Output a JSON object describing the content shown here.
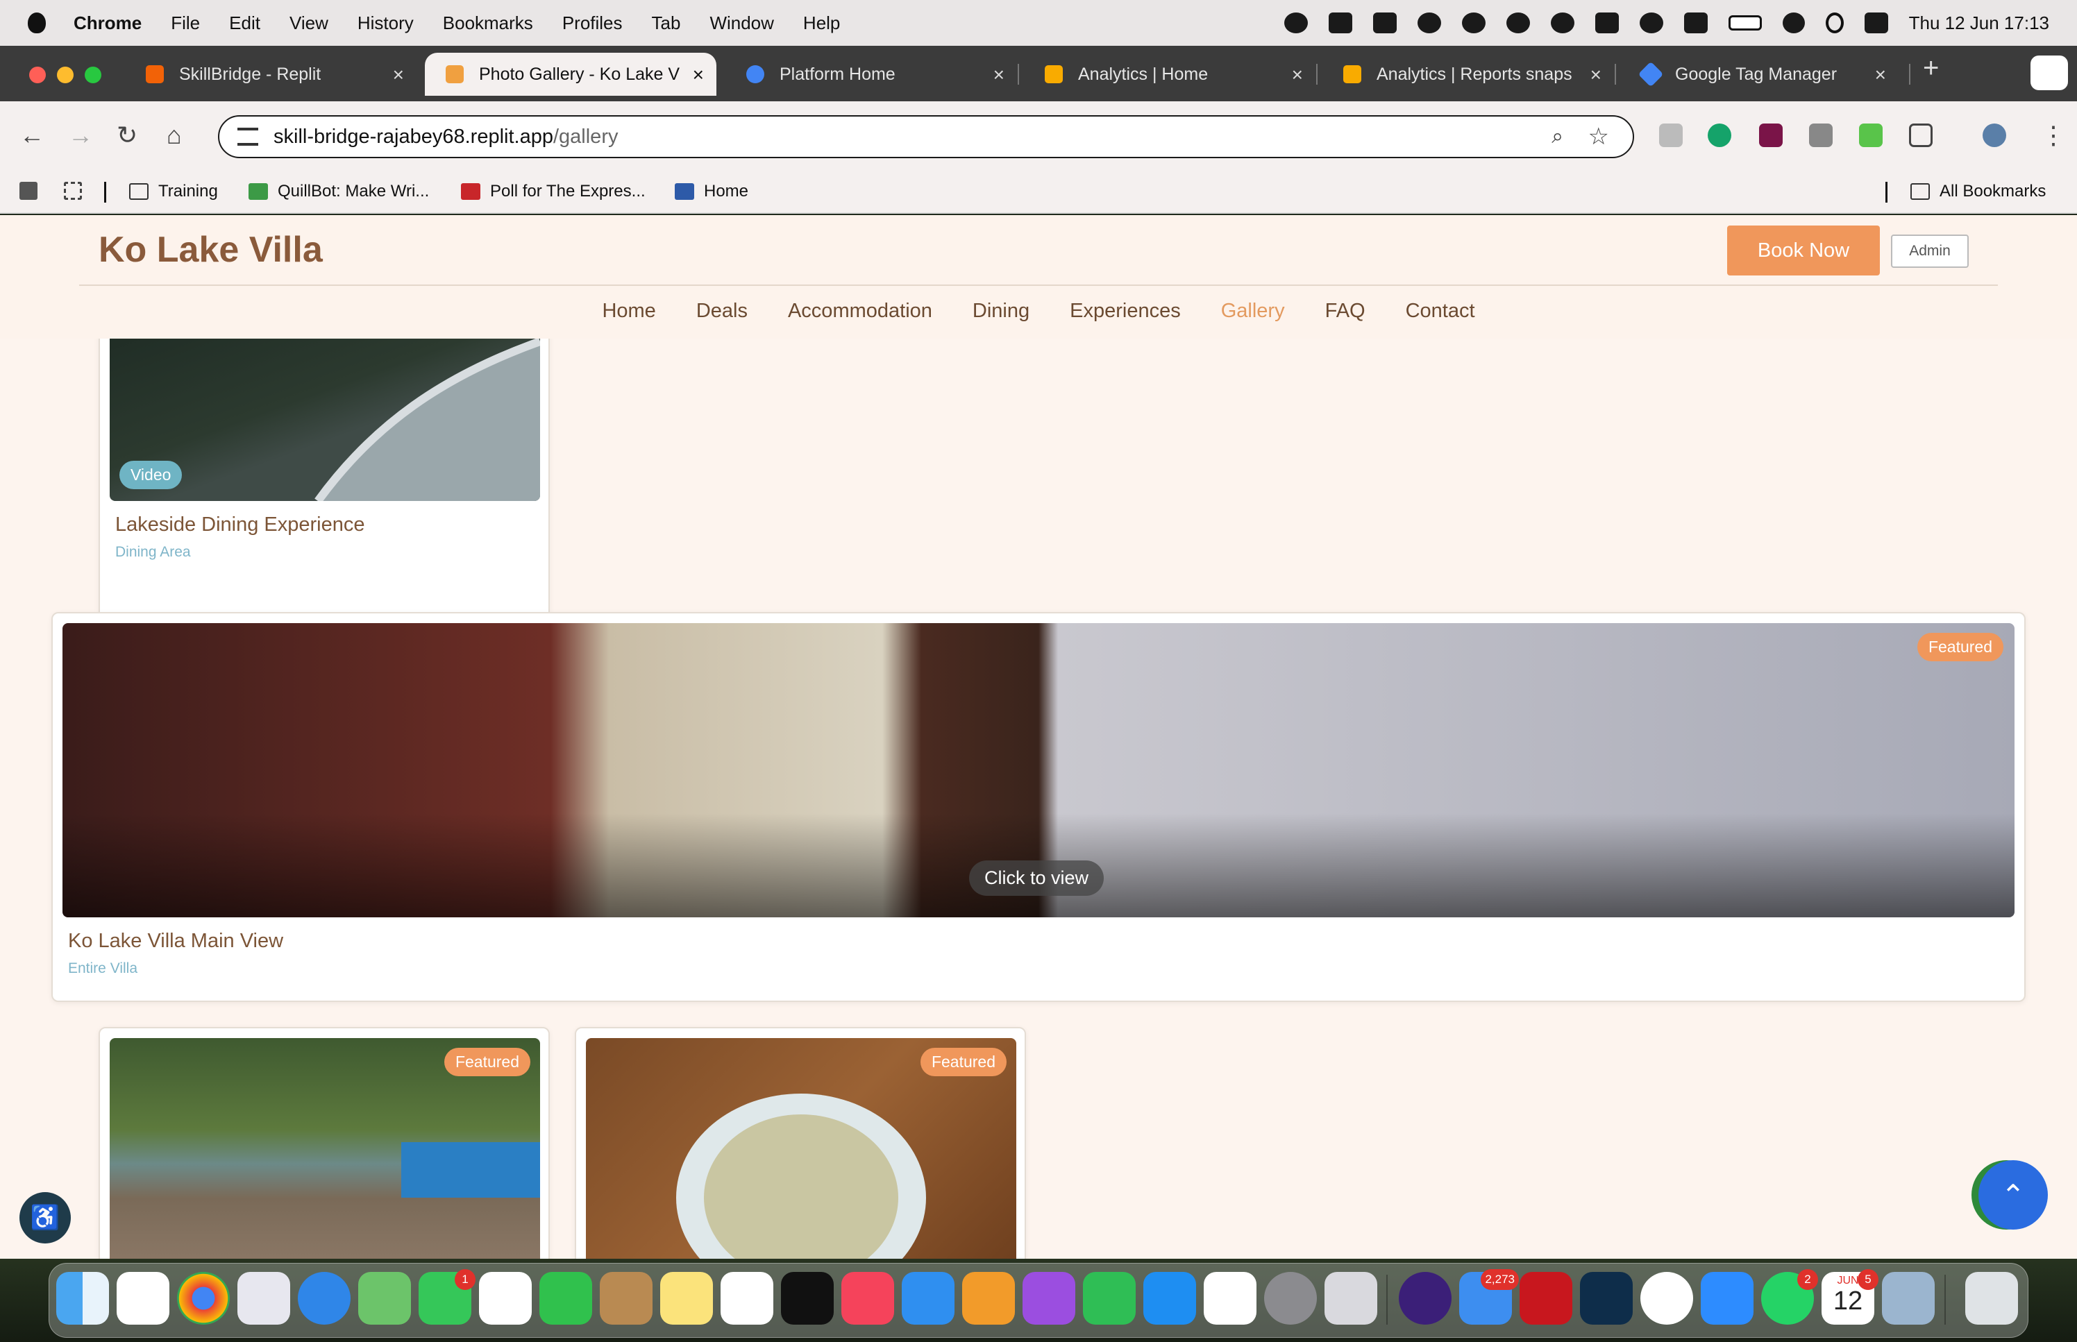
{
  "menubar": {
    "app_name": "Chrome",
    "menus": [
      "File",
      "Edit",
      "View",
      "History",
      "Bookmarks",
      "Profiles",
      "Tab",
      "Window",
      "Help"
    ],
    "clock": "Thu 12 Jun  17:13"
  },
  "tabs": [
    {
      "title": "SkillBridge - Replit",
      "favicon_color": "#f26207"
    },
    {
      "title": "Photo Gallery - Ko Lake V",
      "favicon_color": "#f0a040"
    },
    {
      "title": "Platform Home",
      "favicon_color": "#4285f4"
    },
    {
      "title": "Analytics | Home",
      "favicon_color": "#f9ab00"
    },
    {
      "title": "Analytics | Reports snaps",
      "favicon_color": "#f9ab00"
    },
    {
      "title": "Google Tag Manager",
      "favicon_color": "#4285f4"
    }
  ],
  "omnibox": {
    "host": "skill-bridge-rajabey68.replit.app",
    "path": "/gallery"
  },
  "bookmarks": {
    "items": [
      "Training",
      "QuillBot: Make Wri...",
      "Poll for The Expres...",
      "Home"
    ],
    "all_label": "All Bookmarks"
  },
  "site": {
    "logo": "Ko Lake Villa",
    "book_now": "Book Now",
    "admin": "Admin",
    "nav": [
      "Home",
      "Deals",
      "Accommodation",
      "Dining",
      "Experiences",
      "Gallery",
      "FAQ",
      "Contact"
    ],
    "active_nav": "Gallery"
  },
  "gallery": {
    "video_card": {
      "badge": "Video",
      "title": "Lakeside Dining Experience",
      "category": "Dining Area"
    },
    "featured_card": {
      "badge": "Featured",
      "overlay": "Click to view",
      "title": "Ko Lake Villa Main View",
      "category": "Entire Villa"
    },
    "pool_card": {
      "badge": "Featured"
    },
    "soup_card": {
      "badge": "Featured"
    }
  },
  "dock": {
    "badges": {
      "messages": "1",
      "mail": "2,273",
      "whatsapp": "2",
      "calendar": "5"
    },
    "calendar_month": "JUN",
    "calendar_day": "12"
  },
  "colors": {
    "accent": "#f0975b",
    "brand_brown": "#8a5a3b",
    "page_bg": "#fdf4ee",
    "category_blue": "#7fb5c9"
  }
}
